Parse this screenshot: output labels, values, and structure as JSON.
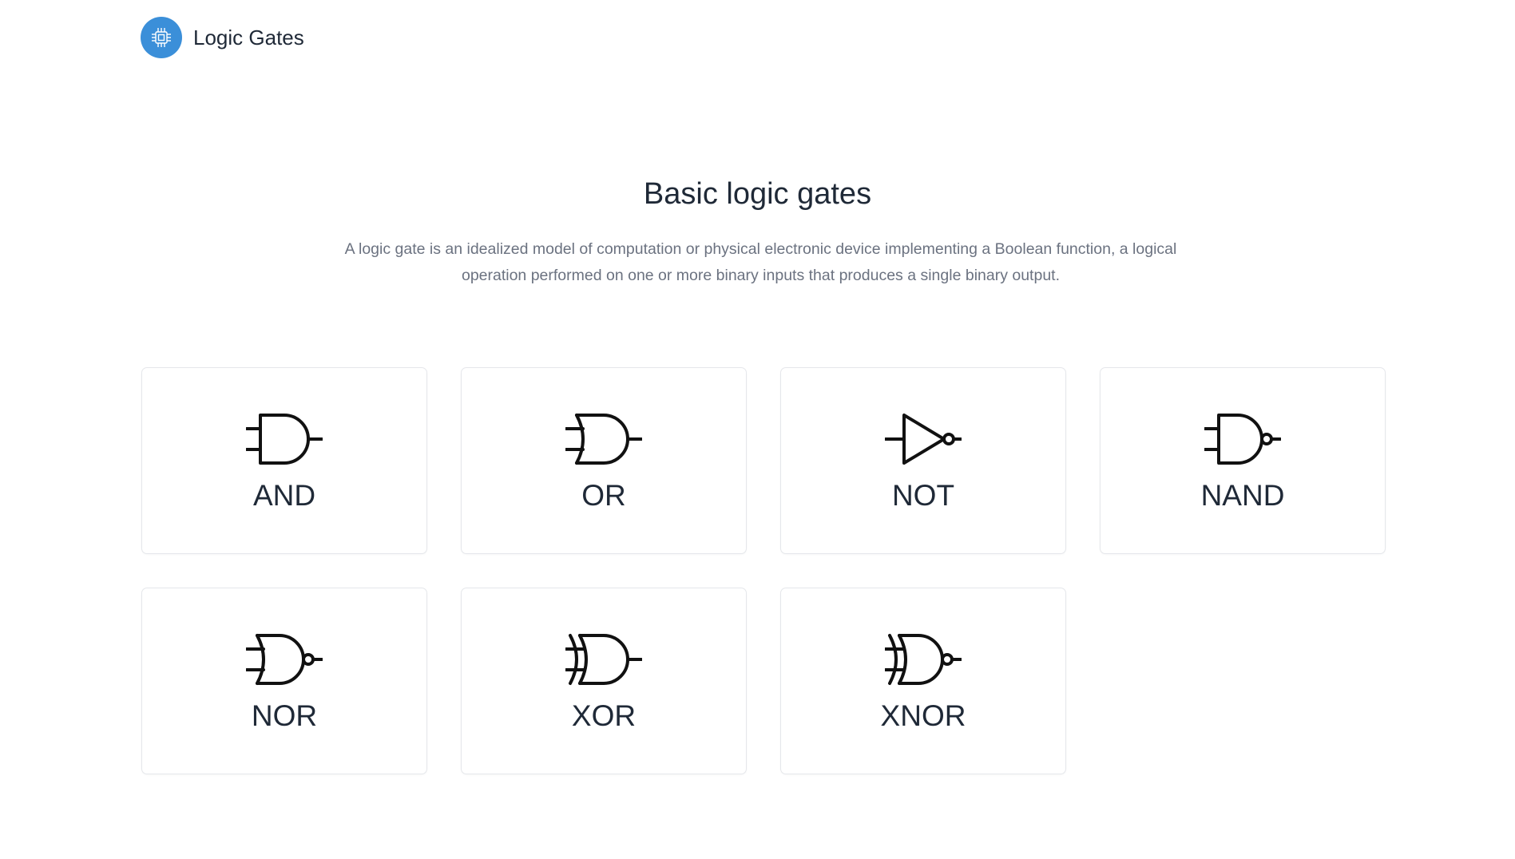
{
  "header": {
    "brand": "Logic Gates",
    "logo_icon": "chip-icon",
    "accent_color": "#3b8fd9"
  },
  "main": {
    "title": "Basic logic gates",
    "description": "A logic gate is an idealized model of computation or physical electronic device implementing a Boolean function, a logical operation performed on one or more binary inputs that produces a single binary output."
  },
  "gates": [
    {
      "label": "AND",
      "icon": "and-gate-icon"
    },
    {
      "label": "OR",
      "icon": "or-gate-icon"
    },
    {
      "label": "NOT",
      "icon": "not-gate-icon"
    },
    {
      "label": "NAND",
      "icon": "nand-gate-icon"
    },
    {
      "label": "NOR",
      "icon": "nor-gate-icon"
    },
    {
      "label": "XOR",
      "icon": "xor-gate-icon"
    },
    {
      "label": "XNOR",
      "icon": "xnor-gate-icon"
    }
  ]
}
